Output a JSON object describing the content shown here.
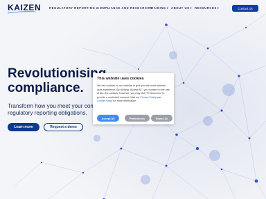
{
  "brand": {
    "logo_text": "KAIZEN"
  },
  "nav": {
    "items": [
      {
        "label": "REGULATORY REPORTING",
        "has_dropdown": true
      },
      {
        "label": "COMPLIANCE AND RESEARCH",
        "has_dropdown": true
      },
      {
        "label": "TRAINING",
        "has_dropdown": true
      },
      {
        "label": "ABOUT US",
        "has_dropdown": true
      },
      {
        "label": "RESOURCES",
        "has_dropdown": true
      }
    ],
    "chevron": "▾",
    "contact_label": "Contact Us"
  },
  "hero": {
    "title_line1": "Revolutionising",
    "title_line2": "compliance.",
    "subtitle_line1": "Transform how you meet your comp",
    "subtitle_line2": "regulatory reporting obligations.",
    "learn_more_label": "Learn more",
    "demo_label": "Request a demo"
  },
  "cookie": {
    "title": "This website uses cookies",
    "text_before": "We use cookies on our website to give you the most relevant user experience. By clicking \"Accept All\", you consent to the use of ALL the cookies. However, you may visit \"Preferences\" to provide a controlled consent. Visit our ",
    "privacy_link": "Privacy Policy",
    "text_mid": " and ",
    "cookie_link": "Cookie Policy",
    "text_after": " for more information.",
    "accept_label": "Accept All",
    "preferences_label": "Preferences",
    "reject_label": "Reject All"
  },
  "colors": {
    "primary": "#0e3a8f",
    "network": "#3f62c8",
    "accept": "#3b8ef0",
    "secondary_button": "#9aa0a6"
  }
}
